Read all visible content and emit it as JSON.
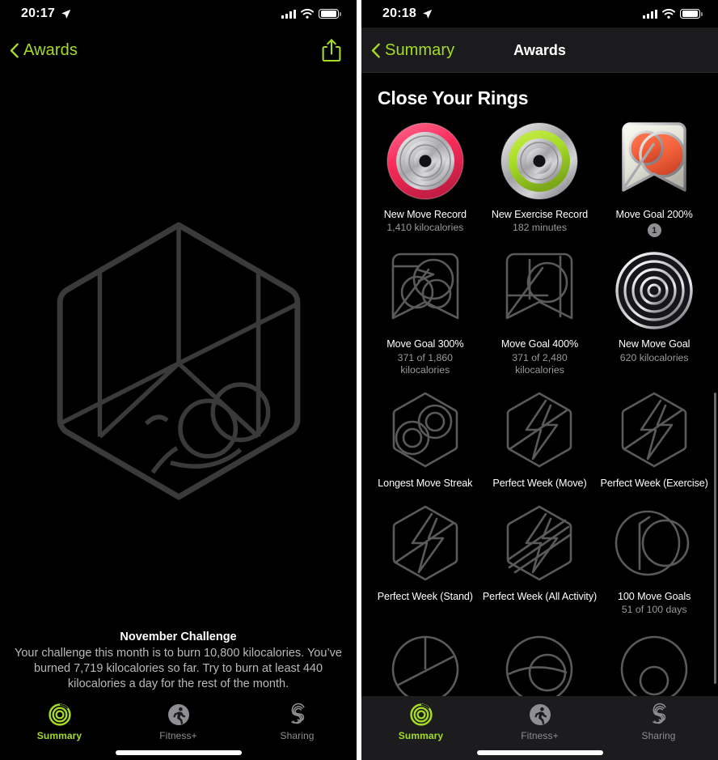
{
  "left_panel": {
    "status": {
      "time": "20:17",
      "location_icon": "location-arrow-icon",
      "signal_icon": "cellular-signal-icon",
      "wifi_icon": "wifi-icon",
      "battery_icon": "battery-icon"
    },
    "nav": {
      "back_label": "Awards",
      "back_icon": "chevron-left-icon",
      "share_icon": "share-icon"
    },
    "badge": {
      "name": "november-challenge-badge",
      "state": "locked"
    },
    "challenge": {
      "title": "November Challenge",
      "description": "Your challenge this month is to burn 10,800 kilocalories. You’ve burned 7,719 kilocalories so far. Try to burn at least 440 kilocalories a day for the rest of the month."
    },
    "tabs": [
      {
        "label": "Summary",
        "icon": "activity-rings-icon",
        "active": true
      },
      {
        "label": "Fitness+",
        "icon": "runner-icon",
        "active": false
      },
      {
        "label": "Sharing",
        "icon": "sharing-s-icon",
        "active": false
      }
    ]
  },
  "right_panel": {
    "status": {
      "time": "20:18",
      "location_icon": "location-arrow-icon",
      "signal_icon": "cellular-signal-icon",
      "wifi_icon": "wifi-icon",
      "battery_icon": "battery-icon"
    },
    "nav": {
      "back_label": "Summary",
      "back_icon": "chevron-left-icon",
      "title": "Awards"
    },
    "section_title": "Close Your Rings",
    "awards": [
      {
        "name": "New Move Record",
        "sub": "1,410 kilocalories",
        "count": null,
        "art": "medal-pink-rings",
        "earned": true
      },
      {
        "name": "New Exercise Record",
        "sub": "182 minutes",
        "count": null,
        "art": "medal-green-rings",
        "earned": true
      },
      {
        "name": "Move Goal 200%",
        "sub": "",
        "count": "1",
        "art": "shield-orange-circles",
        "earned": true
      },
      {
        "name": "Move Goal 300%",
        "sub": "371 of 1,860 kilocalories",
        "count": null,
        "art": "shield-outline-3",
        "earned": false
      },
      {
        "name": "Move Goal 400%",
        "sub": "371 of 2,480 kilocalories",
        "count": null,
        "art": "shield-outline-4",
        "earned": false
      },
      {
        "name": "New Move Goal",
        "sub": "620 kilocalories",
        "count": null,
        "art": "medal-dark-rings",
        "earned": true
      },
      {
        "name": "Longest Move Streak",
        "sub": "",
        "count": null,
        "art": "hex-outline-infinity",
        "earned": false
      },
      {
        "name": "Perfect Week (Move)",
        "sub": "",
        "count": null,
        "art": "hex-outline-bolt",
        "earned": false
      },
      {
        "name": "Perfect Week (Exercise)",
        "sub": "",
        "count": null,
        "art": "hex-outline-bolt",
        "earned": false
      },
      {
        "name": "Perfect Week (Stand)",
        "sub": "",
        "count": null,
        "art": "hex-outline-bolt",
        "earned": false
      },
      {
        "name": "Perfect Week (All Activity)",
        "sub": "",
        "count": null,
        "art": "hex-outline-bolt-stripes",
        "earned": false
      },
      {
        "name": "100 Move Goals",
        "sub": "51 of 100 days",
        "count": null,
        "art": "circle-outline-100",
        "earned": false
      }
    ],
    "tabs": [
      {
        "label": "Summary",
        "icon": "activity-rings-icon",
        "active": true
      },
      {
        "label": "Fitness+",
        "icon": "runner-icon",
        "active": false
      },
      {
        "label": "Sharing",
        "icon": "sharing-s-icon",
        "active": false
      }
    ]
  },
  "colors": {
    "accent_green": "#A5DB26",
    "move_pink": "#FA2D55",
    "exercise_green": "#A6E82C",
    "orange": "#F4623F",
    "tab_inactive": "#8e8e93"
  }
}
